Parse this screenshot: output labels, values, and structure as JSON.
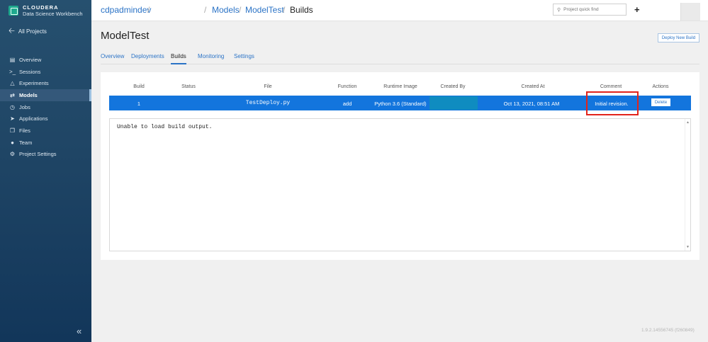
{
  "brand": {
    "name": "CLOUDERA",
    "subtitle": "Data Science Workbench"
  },
  "sidebar": {
    "all_projects": "All Projects",
    "items": [
      {
        "label": "Overview",
        "icon": "overview-icon"
      },
      {
        "label": "Sessions",
        "icon": "terminal-icon"
      },
      {
        "label": "Experiments",
        "icon": "flask-icon"
      },
      {
        "label": "Models",
        "icon": "arrows-icon",
        "active": true
      },
      {
        "label": "Jobs",
        "icon": "clock-icon"
      },
      {
        "label": "Applications",
        "icon": "rocket-icon"
      },
      {
        "label": "Files",
        "icon": "files-icon"
      },
      {
        "label": "Team",
        "icon": "team-icon"
      },
      {
        "label": "Project Settings",
        "icon": "gear-icon"
      }
    ]
  },
  "breadcrumb": {
    "project": "cdpadmindev",
    "models": "Models",
    "model": "ModelTest",
    "current": "Builds"
  },
  "search": {
    "placeholder": "Project quick find"
  },
  "page": {
    "title": "ModelTest",
    "deploy_button": "Deploy New Build"
  },
  "tabs": [
    "Overview",
    "Deployments",
    "Builds",
    "Monitoring",
    "Settings"
  ],
  "active_tab": "Builds",
  "table": {
    "headers": [
      "Build",
      "Status",
      "File",
      "Function",
      "Runtime Image",
      "Created By",
      "Created At",
      "Comment",
      "Actions"
    ],
    "row": {
      "build": "1",
      "status": "",
      "file": "TestDeploy.py",
      "function": "add",
      "runtime_image": "Python 3.6 (Standard)",
      "created_by": "",
      "created_at": "Oct 13, 2021, 08:51 AM",
      "comment": "Initial revision.",
      "action": "Delete"
    }
  },
  "output": "Unable to load build output.",
  "version": "1.9.2.14556745 (f260849)",
  "colors": {
    "accent": "#1375dd",
    "sidebar": "#1f4565",
    "highlight": "#e2231a"
  }
}
